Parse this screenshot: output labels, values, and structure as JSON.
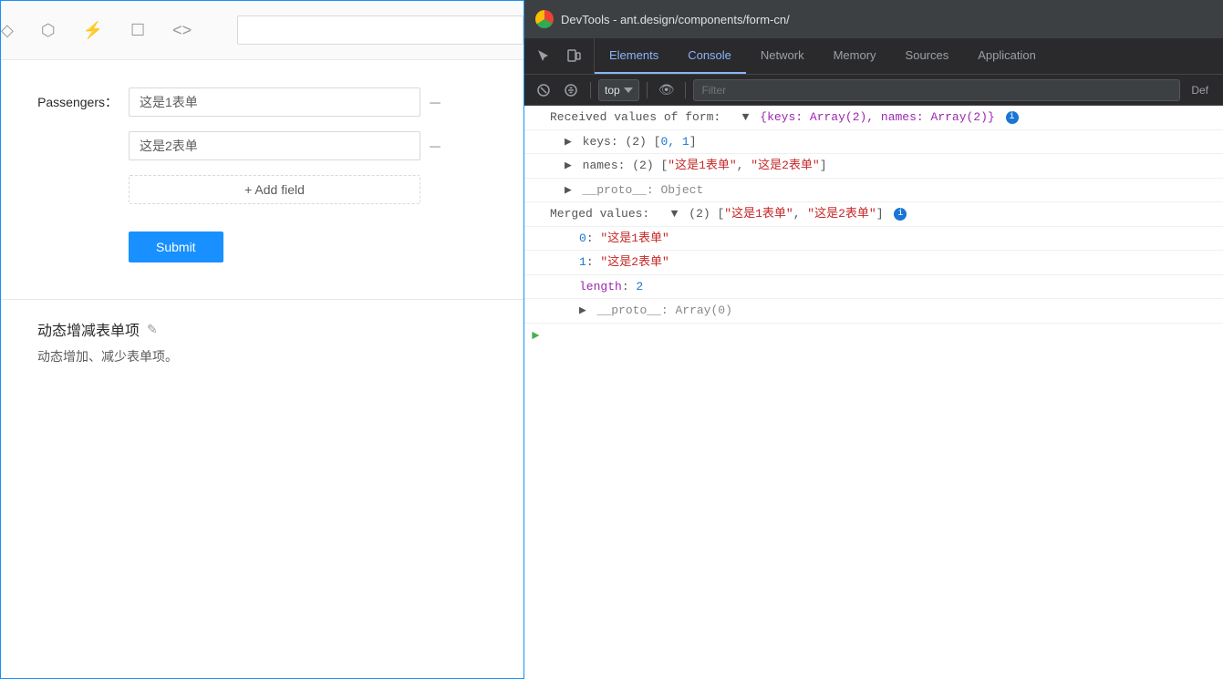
{
  "page": {
    "left_panel": {
      "top_icons": [
        "◇",
        "⬡",
        "⚡",
        "☐",
        "<>"
      ],
      "form": {
        "label": "Passengers：",
        "field1": "这是1表单",
        "field2": "这是2表单",
        "add_field_label": "+ Add field",
        "submit_label": "Submit"
      },
      "bottom_section": {
        "title": "动态增减表单项",
        "edit_icon": "✎",
        "description": "动态增加、减少表单项。"
      }
    },
    "devtools": {
      "title": "DevTools - ant.design/components/form-cn/",
      "tabs": [
        {
          "id": "elements",
          "label": "Elements",
          "active": false
        },
        {
          "id": "console",
          "label": "Console",
          "active": true
        },
        {
          "id": "network",
          "label": "Network",
          "active": false
        },
        {
          "id": "memory",
          "label": "Memory",
          "active": false
        },
        {
          "id": "sources",
          "label": "Sources",
          "active": false
        },
        {
          "id": "application",
          "label": "Application",
          "active": false
        }
      ],
      "toolbar": {
        "context_selector": "top",
        "filter_placeholder": "Filter",
        "def_label": "Def"
      },
      "console_lines": [
        {
          "id": "line1",
          "type": "log",
          "label": "Received values of form:",
          "value": "{keys: Array(2), names: Array(2)}",
          "has_info": true,
          "expanded": true
        },
        {
          "id": "line1a",
          "type": "child",
          "indent": 1,
          "content": "▶ keys: (2) [0, 1]"
        },
        {
          "id": "line1b",
          "type": "child",
          "indent": 1,
          "content": "▶ names: (2) [\"这是1表单\", \"这是2表单\"]"
        },
        {
          "id": "line1c",
          "type": "child",
          "indent": 1,
          "content": "▶ __proto__: Object"
        },
        {
          "id": "line2",
          "type": "log",
          "label": "Merged values:",
          "value": "(2) [\"这是1表单\", \"这是2表单\"]",
          "has_info": true,
          "expanded": true
        },
        {
          "id": "line2a",
          "type": "child",
          "indent": 2,
          "content": "0: \"这是1表单\""
        },
        {
          "id": "line2b",
          "type": "child",
          "indent": 2,
          "content": "1: \"这是2表单\""
        },
        {
          "id": "line2c",
          "type": "child",
          "indent": 2,
          "content": "length: 2"
        },
        {
          "id": "line2d",
          "type": "child",
          "indent": 2,
          "content": "▶ __proto__: Array(0)"
        }
      ]
    }
  }
}
